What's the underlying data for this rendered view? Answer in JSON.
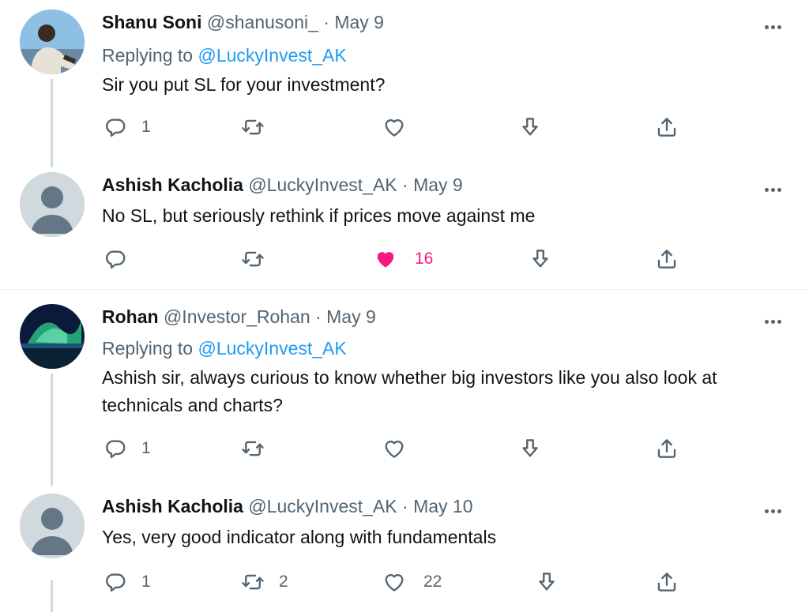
{
  "tweets": [
    {
      "name": "Shanu Soni",
      "handle": "@shanusoni_",
      "sep": "·",
      "date": "May 9",
      "replying_prefix": "Replying to",
      "replying_to": "@LuckyInvest_AK",
      "text": "Sir you put SL for your investment?",
      "reply_count": "1",
      "retweet_count": "",
      "like_count": "",
      "liked": false
    },
    {
      "name": "Ashish Kacholia",
      "handle": "@LuckyInvest_AK",
      "sep": "·",
      "date": "May 9",
      "text": "No SL, but seriously rethink if prices move against me",
      "reply_count": "",
      "retweet_count": "",
      "like_count": "16",
      "liked": true
    },
    {
      "name": "Rohan",
      "handle": "@Investor_Rohan",
      "sep": "·",
      "date": "May 9",
      "replying_prefix": "Replying to",
      "replying_to": "@LuckyInvest_AK",
      "text": "Ashish sir, always curious to know whether big investors like you also look at technicals and charts?",
      "reply_count": "1",
      "retweet_count": "",
      "like_count": "",
      "liked": false
    },
    {
      "name": "Ashish Kacholia",
      "handle": "@LuckyInvest_AK",
      "sep": "·",
      "date": "May 10",
      "text": "Yes, very good indicator along with fundamentals",
      "reply_count": "1",
      "retweet_count": "2",
      "like_count": "22",
      "liked": false
    }
  ],
  "colors": {
    "like_active": "#f91880",
    "link": "#1d9bf0",
    "secondary_text": "#536471"
  }
}
